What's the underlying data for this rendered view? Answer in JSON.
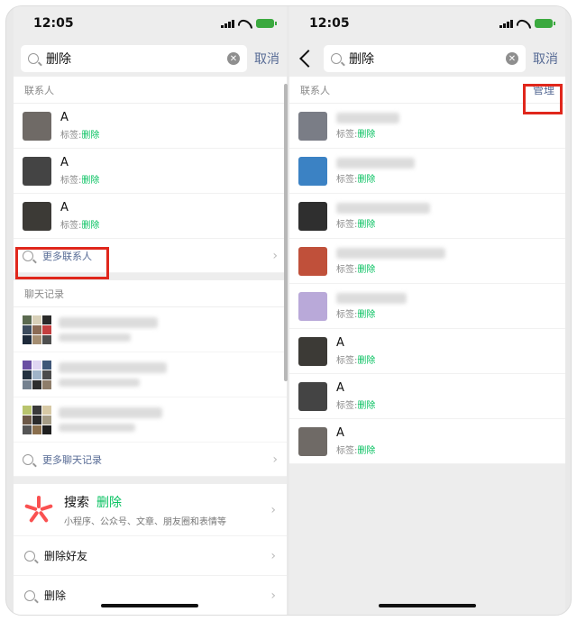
{
  "left": {
    "time": "12:05",
    "search": {
      "query": "删除",
      "cancel": "取消"
    },
    "contacts_header": "联系人",
    "contacts": [
      {
        "name": "A",
        "tag_label": "标签:",
        "tag_value": "删除",
        "avatar_color": "#6f6a66"
      },
      {
        "name": "A",
        "tag_label": "标签:",
        "tag_value": "删除",
        "avatar_color": "#444444"
      },
      {
        "name": "A",
        "tag_label": "标签:",
        "tag_value": "删除",
        "avatar_color": "#3c3a36"
      }
    ],
    "more_contacts": "更多联系人",
    "chats_header": "聊天记录",
    "more_chats": "更多聊天记录",
    "search_online": {
      "title": "搜索",
      "keyword": "删除",
      "subtitle": "小程序、公众号、文章、朋友圈和表情等"
    },
    "suggestions": [
      "删除好友",
      "删除"
    ]
  },
  "right": {
    "time": "12:05",
    "search": {
      "query": "删除",
      "cancel": "取消"
    },
    "contacts_header": "联系人",
    "manage": "管理",
    "contacts": [
      {
        "name": "",
        "tag_label": "标签:",
        "tag_value": "删除",
        "avatar_color": "#7a7d86"
      },
      {
        "name": "",
        "tag_label": "标签:",
        "tag_value": "删除",
        "avatar_color": "#3b82c4"
      },
      {
        "name": "",
        "tag_label": "标签:",
        "tag_value": "删除",
        "avatar_color": "#2f2f2f"
      },
      {
        "name": "",
        "tag_label": "标签:",
        "tag_value": "删除",
        "avatar_color": "#c0503a"
      },
      {
        "name": "",
        "tag_label": "标签:",
        "tag_value": "删除",
        "avatar_color": "#b9a9d9"
      },
      {
        "name": "A",
        "tag_label": "标签:",
        "tag_value": "删除",
        "avatar_color": "#3c3a36"
      },
      {
        "name": "A",
        "tag_label": "标签:",
        "tag_value": "删除",
        "avatar_color": "#444444"
      },
      {
        "name": "A",
        "tag_label": "标签:",
        "tag_value": "删除",
        "avatar_color": "#6f6a66"
      }
    ]
  }
}
